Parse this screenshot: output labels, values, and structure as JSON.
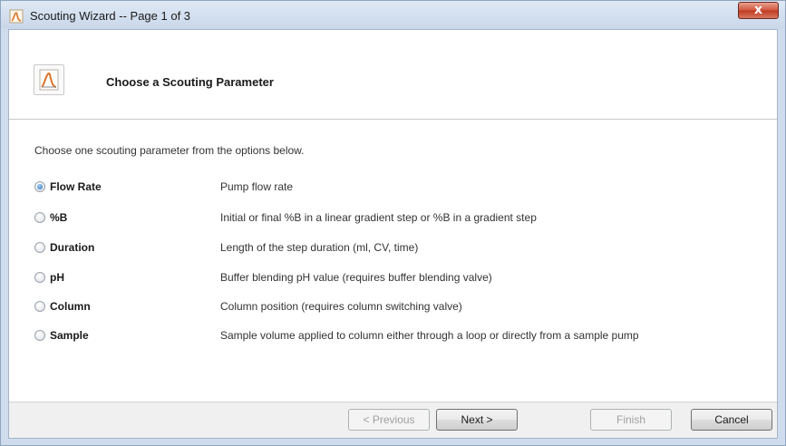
{
  "window": {
    "title": "Scouting Wizard -- Page 1 of 3",
    "close_label": "x"
  },
  "header": {
    "title": "Choose a Scouting Parameter"
  },
  "instruction": "Choose one scouting parameter from the options below.",
  "options": [
    {
      "label": "Flow Rate",
      "description": "Pump flow rate",
      "selected": true
    },
    {
      "label": "%B",
      "description": "Initial or final %B in a linear gradient step or %B in a gradient step",
      "selected": false
    },
    {
      "label": "Duration",
      "description": "Length of the step duration (ml, CV, time)",
      "selected": false
    },
    {
      "label": "pH",
      "description": "Buffer blending pH value (requires buffer blending valve)",
      "selected": false
    },
    {
      "label": "Column",
      "description": "Column position (requires column switching valve)",
      "selected": false
    },
    {
      "label": "Sample",
      "description": "Sample volume applied to column either through a loop or directly from a sample pump",
      "selected": false
    }
  ],
  "buttons": {
    "previous": "< Previous",
    "next": "Next >",
    "finish": "Finish",
    "cancel": "Cancel"
  },
  "colors": {
    "selected_radio": "#2a6fb8",
    "title_bar": "#cfdced",
    "close_button": "#c7452c"
  },
  "icons": {
    "title_icon": "wizard-icon",
    "header_icon": "wizard-icon"
  }
}
